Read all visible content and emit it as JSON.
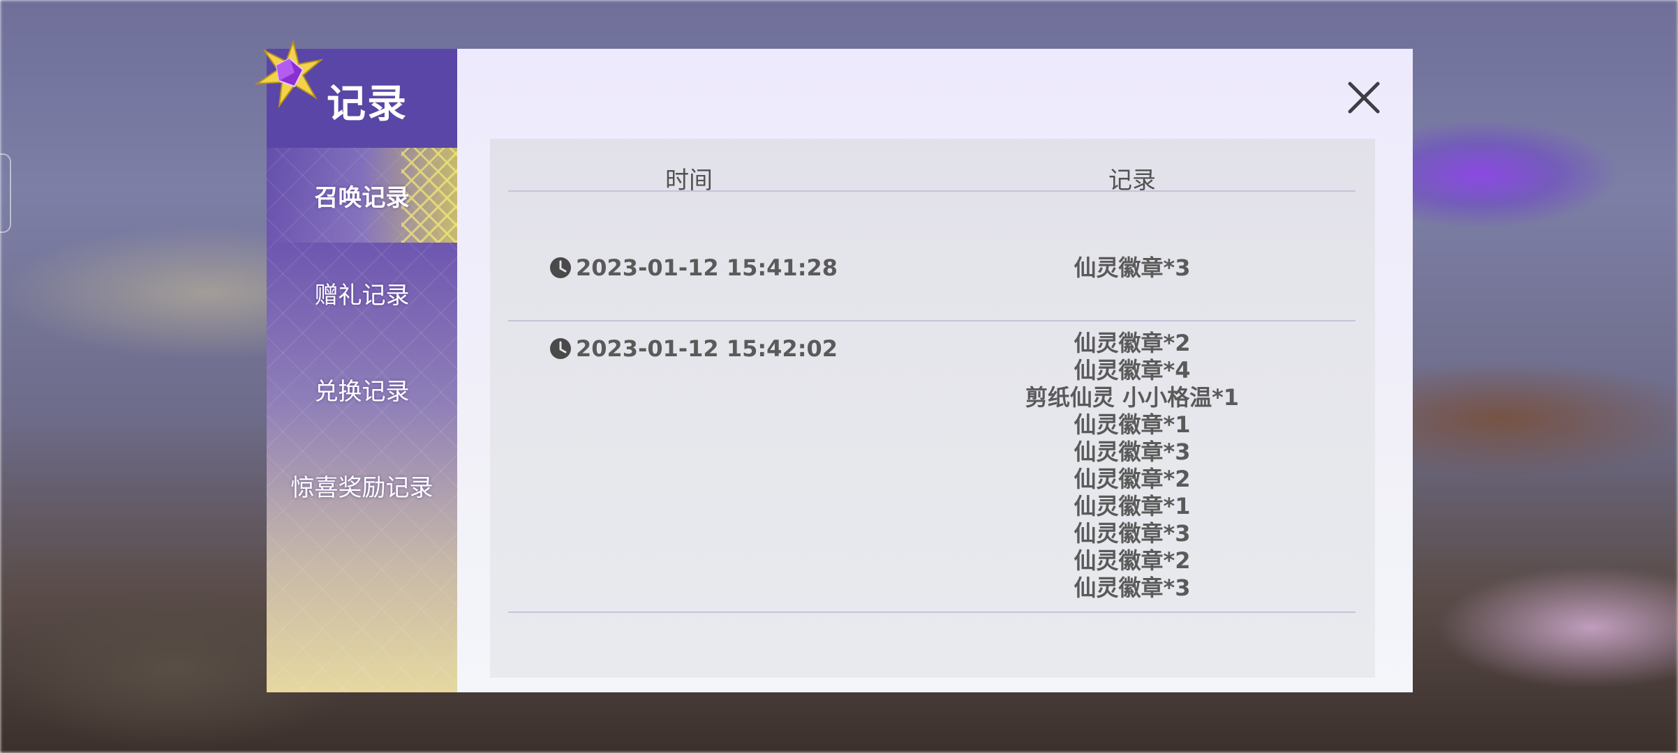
{
  "dialog": {
    "title": "记录",
    "close_label": "×"
  },
  "sidebar": {
    "items": [
      {
        "label": "召唤记录",
        "active": true
      },
      {
        "label": "赠礼记录",
        "active": false
      },
      {
        "label": "兑换记录",
        "active": false
      },
      {
        "label": "惊喜奖励记录",
        "active": false
      }
    ]
  },
  "table": {
    "headers": {
      "time": "时间",
      "record": "记录"
    },
    "rows": [
      {
        "time": "2023-01-12 15:41:28",
        "records": [
          "仙灵徽章*3"
        ]
      },
      {
        "time": "2023-01-12 15:42:02",
        "records": [
          "仙灵徽章*2",
          "仙灵徽章*4",
          "剪纸仙灵 小小格温*1",
          "仙灵徽章*1",
          "仙灵徽章*3",
          "仙灵徽章*2",
          "仙灵徽章*1",
          "仙灵徽章*3",
          "仙灵徽章*2",
          "仙灵徽章*3"
        ]
      }
    ]
  },
  "colors": {
    "sidebar_header": "#5946a6",
    "active_highlight": "#e6dc5a",
    "text_dark": "#5a5a5a",
    "divider": "#c3c4d8"
  },
  "icons": {
    "gem": "purple-gem-star-icon",
    "clock": "clock-icon",
    "close": "close-icon"
  }
}
